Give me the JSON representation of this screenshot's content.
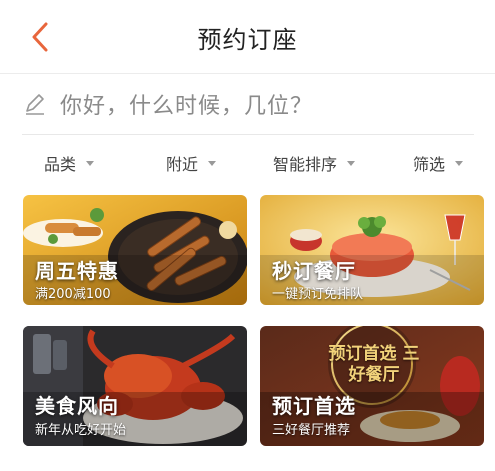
{
  "header": {
    "title": "预约订座",
    "back_icon": "chevron-left-icon"
  },
  "prompt": {
    "text": "你好，什么时候，几位？",
    "icon": "pencil-icon"
  },
  "filters": [
    {
      "label": "品类"
    },
    {
      "label": "附近"
    },
    {
      "label": "智能排序"
    },
    {
      "label": "筛选"
    }
  ],
  "cards": [
    {
      "title": "周五特惠",
      "subtitle": "满200减100"
    },
    {
      "title": "秒订餐厅",
      "subtitle": "一键预订免排队"
    },
    {
      "title": "美食风向",
      "subtitle": "新年从吃好开始"
    },
    {
      "title": "预订首选",
      "subtitle": "三好餐厅推荐",
      "badge_text": "预订首选 三好餐厅"
    }
  ],
  "colors": {
    "accent": "#e8663c",
    "divider": "#ececec",
    "muted_text": "#8a8a8a"
  }
}
